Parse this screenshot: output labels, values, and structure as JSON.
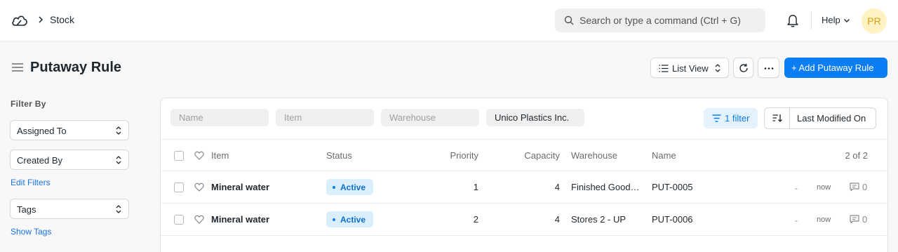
{
  "navbar": {
    "breadcrumb": "Stock",
    "search_placeholder": "Search or type a command (Ctrl + G)",
    "help_label": "Help",
    "avatar_initials": "PR"
  },
  "page": {
    "title": "Putaway Rule",
    "list_view_label": "List View",
    "primary_action_label": "+ Add Putaway Rule"
  },
  "sidebar": {
    "filter_by_label": "Filter By",
    "assigned_to_label": "Assigned To",
    "created_by_label": "Created By",
    "edit_filters_label": "Edit Filters",
    "tags_label": "Tags",
    "show_tags_label": "Show Tags"
  },
  "filters": {
    "name_placeholder": "Name",
    "item_placeholder": "Item",
    "warehouse_placeholder": "Warehouse",
    "supplier_value": "Unico Plastics Inc.",
    "filter_count_label": "1 filter",
    "sort_label": "Last Modified On"
  },
  "table": {
    "headers": {
      "item": "Item",
      "status": "Status",
      "priority": "Priority",
      "capacity": "Capacity",
      "warehouse": "Warehouse",
      "name": "Name",
      "count": "2 of 2"
    },
    "rows": [
      {
        "item": "Mineral water",
        "status": "Active",
        "priority": "1",
        "capacity": "4",
        "warehouse": "Finished Good…",
        "name": "PUT-0005",
        "assigned": "-",
        "modified": "now",
        "comments": "0"
      },
      {
        "item": "Mineral water",
        "status": "Active",
        "priority": "2",
        "capacity": "4",
        "warehouse": "Stores 2 - UP",
        "name": "PUT-0006",
        "assigned": "-",
        "modified": "now",
        "comments": "0"
      }
    ]
  },
  "colors": {
    "primary": "#0b7ef5",
    "badge_bg": "#dbeefc",
    "avatar_bg": "#fff3c4"
  },
  "icons": [
    "app-logo-icon",
    "chevron-right-icon",
    "search-icon",
    "bell-icon",
    "chevron-down-icon",
    "hamburger-icon",
    "list-icon",
    "up-down-icon",
    "refresh-icon",
    "ellipsis-icon",
    "filter-icon",
    "sort-icon",
    "heart-icon",
    "comment-icon"
  ]
}
